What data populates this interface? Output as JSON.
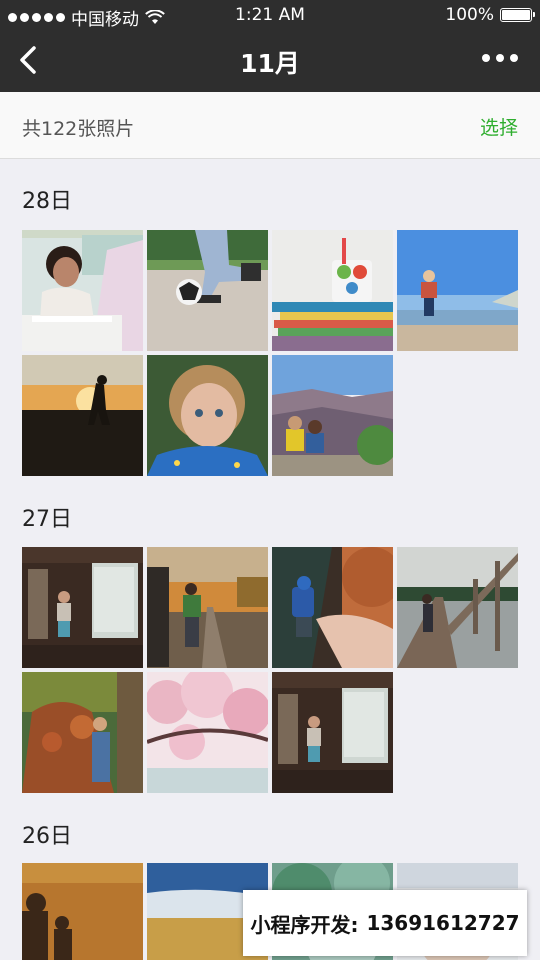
{
  "status": {
    "carrier": "中国移动",
    "time": "1:21 AM",
    "battery": "100%"
  },
  "nav": {
    "title": "11月"
  },
  "summary": {
    "count": "共122张照片",
    "select": "选择"
  },
  "groups": [
    {
      "date": "28日",
      "photos": [
        "girl reading",
        "kid playing football",
        "books with mug",
        "toddler on beach",
        "child silhouette at sunset",
        "toddler blue shirt",
        "kids at canyon"
      ]
    },
    {
      "date": "27日",
      "photos": [
        "child at window",
        "girl on railway",
        "toy figure in hand",
        "child on pier",
        "child in leaf pile",
        "cherry blossom",
        "child at window"
      ]
    },
    {
      "date": "26日",
      "photos": [
        "silhouettes by water",
        "wheat field",
        "blurred green",
        "portrait"
      ]
    }
  ],
  "ad": {
    "label": "小程序开发:",
    "phone": "13691612727"
  }
}
